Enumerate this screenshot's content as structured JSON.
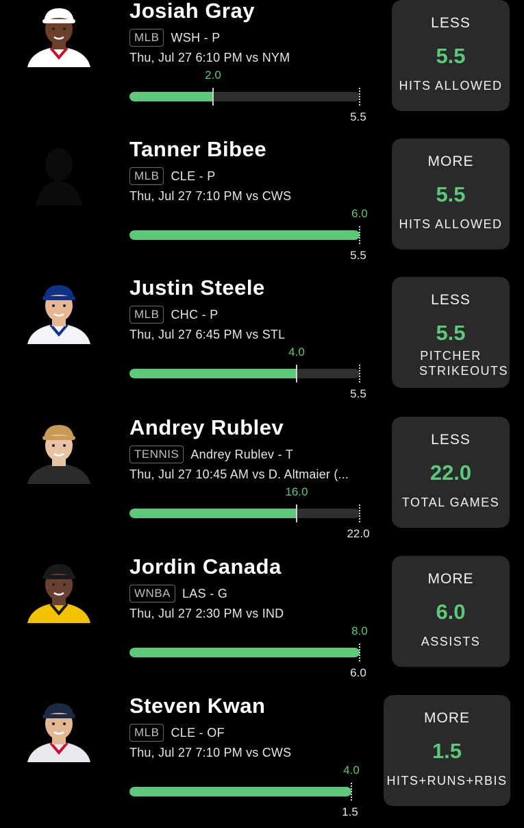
{
  "picks": [
    {
      "name": "Josiah Gray",
      "league": "MLB",
      "team": "WSH - P",
      "game": "Thu, Jul 27 6:10 PM  vs NYM",
      "projection": "2.0",
      "line": "5.5",
      "fill": 0.364,
      "direction": "LESS",
      "stat": "HITS ALLOWED",
      "avatar": {
        "icon": "player-photo-icon",
        "skin": "#6b3f2a",
        "cap": "#ffffff",
        "jersey": "#ffffff",
        "trim": "#c8102e"
      }
    },
    {
      "name": "Tanner Bibee",
      "league": "MLB",
      "team": "CLE - P",
      "game": "Thu, Jul 27 7:10 PM  vs CWS",
      "projection": "6.0",
      "line": "5.5",
      "fill": 1.0,
      "direction": "MORE",
      "stat": "HITS ALLOWED",
      "avatar": {
        "icon": "player-silhouette-icon",
        "skin": "#0a0a0a",
        "cap": "#0a0a0a",
        "jersey": "#0a0a0a",
        "trim": "#0a0a0a"
      }
    },
    {
      "name": "Justin Steele",
      "league": "MLB",
      "team": "CHC - P",
      "game": "Thu, Jul 27 6:45 PM  vs STL",
      "projection": "4.0",
      "line": "5.5",
      "fill": 0.727,
      "direction": "LESS",
      "stat": "PITCHER STRIKEOUTS",
      "avatar": {
        "icon": "player-photo-icon",
        "skin": "#e8b896",
        "cap": "#0e3386",
        "jersey": "#f2f4f8",
        "trim": "#0e3386"
      }
    },
    {
      "name": "Andrey Rublev",
      "league": "TENNIS",
      "team": "Andrey Rublev - T",
      "game": "Thu, Jul 27 10:45 AM  vs D. Altmaier (...",
      "projection": "16.0",
      "line": "22.0",
      "fill": 0.727,
      "direction": "LESS",
      "stat": "TOTAL GAMES",
      "avatar": {
        "icon": "player-photo-icon",
        "skin": "#e9c4a4",
        "cap": "#c79a55",
        "jersey": "#2b2b2b",
        "trim": "#2b2b2b"
      }
    },
    {
      "name": "Jordin Canada",
      "league": "WNBA",
      "team": "LAS - G",
      "game": "Thu, Jul 27 2:30 PM  vs IND",
      "projection": "8.0",
      "line": "6.0",
      "fill": 1.0,
      "direction": "MORE",
      "stat": "ASSISTS",
      "avatar": {
        "icon": "player-photo-icon",
        "skin": "#6a4030",
        "cap": "#1a1a1a",
        "jersey": "#f2c200",
        "trim": "#1a1a1a"
      }
    },
    {
      "name": "Steven Kwan",
      "league": "MLB",
      "team": "CLE - OF",
      "game": "Thu, Jul 27 7:10 PM  vs CWS",
      "projection": "4.0",
      "line": "1.5",
      "fill": 1.0,
      "direction": "MORE",
      "stat": "HITS+RUNS+RBIS",
      "avatar": {
        "icon": "player-photo-icon",
        "skin": "#e2b894",
        "cap": "#1b2a45",
        "jersey": "#e8e8ee",
        "trim": "#c8102e"
      }
    }
  ],
  "colors": {
    "accent": "#5cc87a",
    "card": "#2a2a2a",
    "track": "#2f2f2f",
    "background": "#000000"
  }
}
